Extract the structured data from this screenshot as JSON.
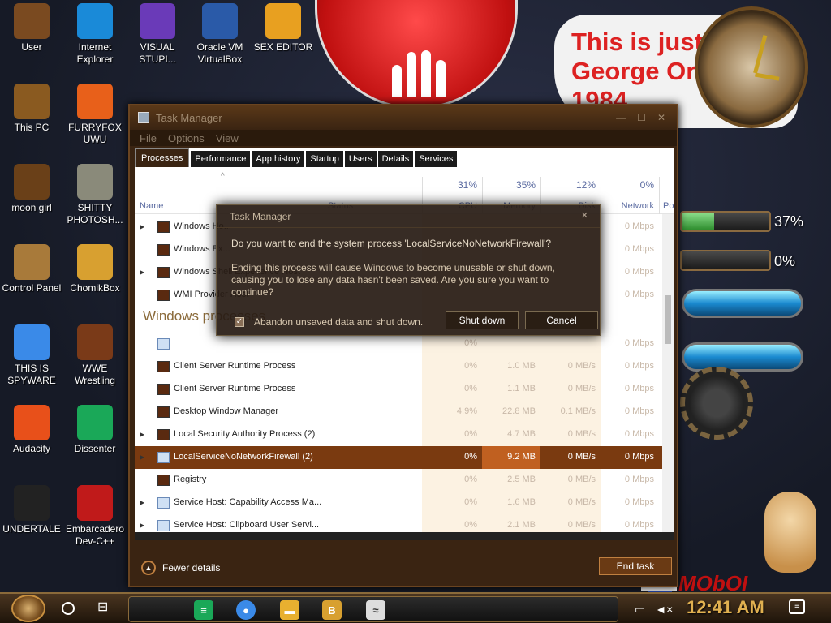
{
  "desktop": {
    "icons": [
      {
        "label": "User",
        "icon": "user-folder-icon",
        "color": "#7a4a20"
      },
      {
        "label": "Internet Explorer",
        "icon": "edge-icon",
        "color": "#1a8ad8"
      },
      {
        "label": "VISUAL STUPI...",
        "icon": "visual-studio-icon",
        "color": "#6a3ab8"
      },
      {
        "label": "Oracle VM VirtualBox",
        "icon": "virtualbox-icon",
        "color": "#2a5aa8"
      },
      {
        "label": "SEX EDITOR",
        "icon": "hxd-icon",
        "color": "#e8a020"
      },
      {
        "label": "This PC",
        "icon": "this-pc-icon",
        "color": "#8a5a20"
      },
      {
        "label": "FURRYFOX UWU",
        "icon": "firefox-icon",
        "color": "#e8601a"
      },
      {
        "label": "moon girl",
        "icon": "moon-girl-icon",
        "color": "#6a4018"
      },
      {
        "label": "SHITTY PHOTOSH...",
        "icon": "gimp-icon",
        "color": "#8a8a7a"
      },
      {
        "label": "Control Panel",
        "icon": "control-panel-icon",
        "color": "#a87a3a"
      },
      {
        "label": "ChomikBox",
        "icon": "chomikbox-icon",
        "color": "#d8a030"
      },
      {
        "label": "THIS IS SPYWARE",
        "icon": "chrome-icon",
        "color": "#3a8ae8"
      },
      {
        "label": "WWE Wrestling",
        "icon": "wwe-icon",
        "color": "#7a3a18"
      },
      {
        "label": "Audacity",
        "icon": "audacity-icon",
        "color": "#e8501a"
      },
      {
        "label": "Dissenter",
        "icon": "dissenter-icon",
        "color": "#1aa858"
      },
      {
        "label": "UNDERTALE",
        "icon": "unity-icon",
        "color": "#222222"
      },
      {
        "label": "Embarcadero Dev-C++",
        "icon": "devcpp-icon",
        "color": "#c01a1a"
      }
    ],
    "note_text": "This is just like George Orwell's 1984",
    "gauge1_value": "37%",
    "gauge1_level": 0.37,
    "gauge2_value": "0%",
    "gauge2_level": 0.0,
    "brand_text": "MObOI"
  },
  "task_manager": {
    "title": "Task Manager",
    "menu": [
      "File",
      "Options",
      "View"
    ],
    "tabs": [
      "Processes",
      "Performance",
      "App history",
      "Startup",
      "Users",
      "Details",
      "Services"
    ],
    "active_tab": "Processes",
    "columns": {
      "name": "Name",
      "status": "Status",
      "cpu_pct": "31%",
      "cpu": "CPU",
      "mem_pct": "35%",
      "mem": "Memory",
      "disk_pct": "12%",
      "disk": "Disk",
      "net_pct": "0%",
      "net": "Network",
      "power": "Po"
    },
    "app_rows": [
      {
        "name": "Windows Ho...",
        "cpu": "",
        "mem": "",
        "disk": "",
        "net": "0 Mbps"
      },
      {
        "name": "Windows Ex...",
        "cpu": "",
        "mem": "",
        "disk": "",
        "net": "0 Mbps"
      },
      {
        "name": "Windows Shell Experience Host",
        "cpu": "",
        "mem": "",
        "disk": "",
        "net": "0 Mbps"
      },
      {
        "name": "WMI Provider Host",
        "cpu": "",
        "mem": "",
        "disk": "",
        "net": "0 Mbps"
      }
    ],
    "group_title": "Windows processes",
    "win_rows": [
      {
        "name": "",
        "cpu": "0%",
        "mem": "",
        "disk": "",
        "net": "0 Mbps"
      },
      {
        "name": "Client Server Runtime Process",
        "cpu": "0%",
        "mem": "1.0 MB",
        "disk": "0 MB/s",
        "net": "0 Mbps"
      },
      {
        "name": "Client Server Runtime Process",
        "cpu": "0%",
        "mem": "1.1 MB",
        "disk": "0 MB/s",
        "net": "0 Mbps"
      },
      {
        "name": "Desktop Window Manager",
        "cpu": "4.9%",
        "mem": "22.8 MB",
        "disk": "0.1 MB/s",
        "net": "0 Mbps"
      },
      {
        "name": "Local Security Authority Process (2)",
        "cpu": "0%",
        "mem": "4.7 MB",
        "disk": "0 MB/s",
        "net": "0 Mbps"
      },
      {
        "name": "LocalServiceNoNetworkFirewall (2)",
        "cpu": "0%",
        "mem": "9.2 MB",
        "disk": "0 MB/s",
        "net": "0 Mbps"
      },
      {
        "name": "Registry",
        "cpu": "0%",
        "mem": "2.5 MB",
        "disk": "0 MB/s",
        "net": "0 Mbps"
      },
      {
        "name": "Service Host: Capability Access Ma...",
        "cpu": "0%",
        "mem": "1.6 MB",
        "disk": "0 MB/s",
        "net": "0 Mbps"
      },
      {
        "name": "Service Host: Clipboard User Servi...",
        "cpu": "0%",
        "mem": "2.1 MB",
        "disk": "0 MB/s",
        "net": "0 Mbps"
      }
    ],
    "fewer_details": "Fewer details",
    "end_task": "End task"
  },
  "dialog": {
    "title": "Task Manager",
    "question": "Do you want to end the system process 'LocalServiceNoNetworkFirewall'?",
    "message": "Ending this process will cause Windows to become unusable or shut down, causing you to lose any data hasn't been saved. Are you sure you want to continue?",
    "checkbox_label": "Abandon unsaved data and shut down.",
    "checkbox_checked": true,
    "shutdown_label": "Shut down",
    "cancel_label": "Cancel"
  },
  "taskbar": {
    "time": "12:41 AM"
  }
}
